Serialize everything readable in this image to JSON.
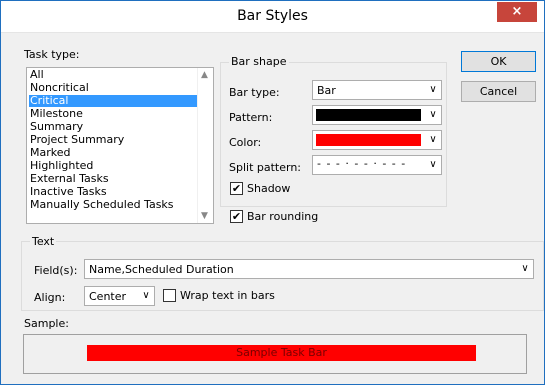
{
  "window": {
    "title": "Bar Styles",
    "close_glyph": "×"
  },
  "task_type": {
    "label": "Task type:",
    "items": [
      "All",
      "Noncritical",
      "Critical",
      "Milestone",
      "Summary",
      "Project Summary",
      "Marked",
      "Highlighted",
      "External Tasks",
      "Inactive Tasks",
      "Manually Scheduled Tasks"
    ],
    "selected": "Critical"
  },
  "bar_shape": {
    "group_label": "Bar shape",
    "bar_type_label": "Bar type:",
    "bar_type_value": "Bar",
    "pattern_label": "Pattern:",
    "pattern_color": "#000000",
    "color_label": "Color:",
    "color_value": "#ff0000",
    "split_pattern_label": "Split pattern:",
    "shadow_label": "Shadow",
    "shadow_checked": true
  },
  "bar_rounding": {
    "label": "Bar rounding",
    "checked": true
  },
  "buttons": {
    "ok": "OK",
    "cancel": "Cancel"
  },
  "text_group": {
    "group_label": "Text",
    "fields_label": "Field(s):",
    "fields_value": "Name,Scheduled Duration",
    "align_label": "Align:",
    "align_value": "Center",
    "wrap_label": "Wrap text in bars",
    "wrap_checked": false
  },
  "sample": {
    "label": "Sample:",
    "bar_text": "Sample Task Bar",
    "bar_color": "#ff0000"
  },
  "icons": {
    "dropdown": "chevron-down-icon",
    "scroll_up": "scroll-up-icon",
    "scroll_down": "scroll-down-icon",
    "check": "check-icon"
  }
}
